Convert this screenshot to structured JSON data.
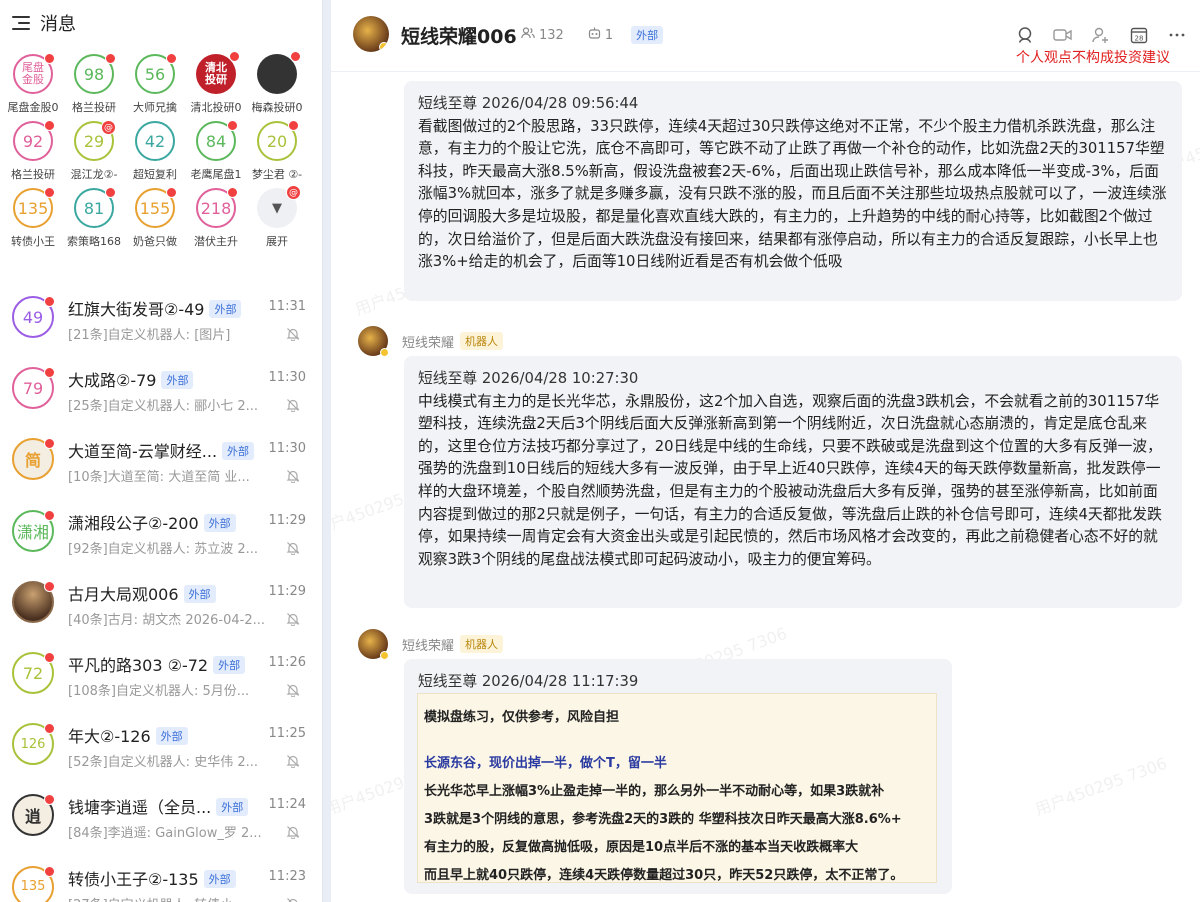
{
  "sidebar": {
    "title": "消息",
    "groups": [
      {
        "avatar_text": "尾盘\n金股",
        "label": "尾盘金股0",
        "color": "#e0609a",
        "dot": "dot"
      },
      {
        "avatar_text": "98",
        "label": "格兰投研",
        "color": "#5bb85b",
        "dot": "dot"
      },
      {
        "avatar_text": "56",
        "label": "大师兄擒",
        "color": "#5bb85b",
        "dot": "dot"
      },
      {
        "avatar_text": "清北\n投研",
        "label": "清北投研0",
        "color": "#c0202a",
        "dot": "dot",
        "img": true
      },
      {
        "avatar_text": "",
        "label": "梅森投研0",
        "color": "#333333",
        "dot": "dot",
        "img": true
      },
      {
        "avatar_text": "92",
        "label": "格兰投研",
        "color": "#e0609a",
        "dot": "dot"
      },
      {
        "avatar_text": "29",
        "label": "混江龙②-",
        "color": "#a8c23a",
        "dot": "@"
      },
      {
        "avatar_text": "42",
        "label": "超短复利",
        "color": "#3aa8a0",
        "dot": ""
      },
      {
        "avatar_text": "84",
        "label": "老鹰尾盘1",
        "color": "#5bb85b",
        "dot": "dot"
      },
      {
        "avatar_text": "20",
        "label": "梦尘君 ②-",
        "color": "#a8c23a",
        "dot": "dot"
      },
      {
        "avatar_text": "135",
        "label": "转债小王",
        "color": "#e8a030",
        "dot": "dot"
      },
      {
        "avatar_text": "81",
        "label": "索策略168",
        "color": "#3aa8a0",
        "dot": "dot"
      },
      {
        "avatar_text": "155",
        "label": "奶爸只做",
        "color": "#e8a030",
        "dot": "dot"
      },
      {
        "avatar_text": "218",
        "label": "潜伏主升",
        "color": "#e0609a",
        "dot": "dot"
      },
      {
        "avatar_text": "▼",
        "label": "展开",
        "color": "#dddddd",
        "dot": "@",
        "expand": true
      }
    ],
    "conversations": [
      {
        "avatar_text": "49",
        "color": "#9b5de5",
        "name": "红旗大街发哥②-49",
        "badge": "外部",
        "time": "11:31",
        "preview": "[21条]自定义机器人: [图片]"
      },
      {
        "avatar_text": "79",
        "color": "#e0609a",
        "name": "大成路②-79",
        "badge": "外部",
        "time": "11:30",
        "preview": "[25条]自定义机器人: 郦小七 2..."
      },
      {
        "avatar_text": "简",
        "color": "#e8a030",
        "name": "大道至简-云掌财经...",
        "badge": "外部",
        "time": "11:30",
        "preview": "[10条]大道至简: 大道至简 业...",
        "img": true
      },
      {
        "avatar_text": "潇湘",
        "color": "#5bb85b",
        "name": "潇湘段公子②-200",
        "badge": "外部",
        "time": "11:29",
        "preview": "[92条]自定义机器人: 苏立波 2..."
      },
      {
        "avatar_text": "",
        "color": "#8a6a4a",
        "name": "古月大局观006",
        "badge": "外部",
        "time": "11:29",
        "preview": "[40条]古月: 胡文杰 2026-04-2...",
        "img": true
      },
      {
        "avatar_text": "72",
        "color": "#a8c23a",
        "name": "平凡的路303 ②-72",
        "badge": "外部",
        "time": "11:26",
        "preview": "[108条]自定义机器人: 5月份..."
      },
      {
        "avatar_text": "126",
        "color": "#a8c23a",
        "name": "年大②-126",
        "badge": "外部",
        "time": "11:25",
        "preview": "[52条]自定义机器人: 史华伟 2..."
      },
      {
        "avatar_text": "逍",
        "color": "#333333",
        "name": "钱塘李逍遥（全员...",
        "badge": "外部",
        "time": "11:24",
        "preview": "[84条]李逍遥: GainGlow_罗 2...",
        "img": true
      },
      {
        "avatar_text": "135",
        "color": "#e8a030",
        "name": "转债小王子②-135",
        "badge": "外部",
        "time": "11:23",
        "preview": "[27条]自定义机器人: 转债小..."
      }
    ]
  },
  "chat": {
    "title": "短线荣耀006",
    "members": "132",
    "robots": "1",
    "badge": "外部",
    "disclaimer": "个人观点不构成投资建议",
    "watermark": "用户450295 7306",
    "messages": [
      {
        "sender": "",
        "tag": "",
        "head": "短线至尊 2026/04/28 09:56:44",
        "body": "看截图做过的2个股思路，33只跌停，连续4天超过30只跌停这绝对不正常，不少个股主力借机杀跌洗盘，那么注意，有主力的个股让它洗，底仓不高即可，等它跌不动了止跌了再做一个补仓的动作，比如洗盘2天的301157华塑科技，昨天最高大涨8.5%新高，假设洗盘被套2天-6%，后面出现止跌信号补，那么成本降低一半变成-3%，后面涨幅3%就回本，涨多了就是多赚多赢，没有只跌不涨的股，而且后面不关注那些垃圾热点股就可以了，一波连续涨停的回调股大多是垃圾股，都是量化喜欢直线大跌的，有主力的，上升趋势的中线的耐心持等，比如截图2个做过的，次日给溢价了，但是后面大跌洗盘没有接回来，结果都有涨停启动，所以有主力的合适反复跟踪，小长早上也涨3%+给走的机会了，后面等10日线附近看是否有机会做个低吸"
      },
      {
        "sender": "短线荣耀",
        "tag": "机器人",
        "head": "短线至尊 2026/04/28 10:27:30",
        "body": "中线模式有主力的是长光华芯，永鼎股份，这2个加入自选，观察后面的洗盘3跌机会，不会就看之前的301157华塑科技，连续洗盘2天后3个阴线后面大反弹涨新高到第一个阴线附近，次日洗盘就心态崩溃的，肯定是底仓乱来的，这里仓位方法技巧都分享过了，20日线是中线的生命线，只要不跌破或是洗盘到这个位置的大多有反弹一波，强势的洗盘到10日线后的短线大多有一波反弹，由于早上近40只跌停，连续4天的每天跌停数量新高，批发跌停一样的大盘环境差，个股自然顺势洗盘，但是有主力的个股被动洗盘后大多有反弹，强势的甚至涨停新高，比如前面内容提到做过的那2只就是例子，一句话，有主力的合适反复做，等洗盘后止跌的补仓信号即可，连续4天都批发跌停，如果持续一周肯定会有大资金出头或是引起民愤的，然后市场风格才会改变的，再此之前稳健者心态不好的就观察3跌3个阴线的尾盘战法模式即可起码波动小，吸主力的便宜筹码。"
      },
      {
        "sender": "短线荣耀",
        "tag": "机器人",
        "head": "短线至尊 2026/04/28 11:17:39",
        "body": ""
      }
    ],
    "image_note": {
      "line1": "模拟盘练习，仅供参考，风险自担",
      "line2": "长源东谷，现价出掉一半，做个T，留一半",
      "line3": "长光华芯早上涨幅3%止盈走掉一半的，那么另外一半不动耐心等，如果3跌就补",
      "line4": "3跌就是3个阴线的意思，参考洗盘2天的3跌的 华塑科技次日昨天最高大涨8.6%+",
      "line5": "有主力的股，反复做高抛低吸，原因是10点半后不涨的基本当天收跌概率大",
      "line6": "而且早上就40只跌停，连续4天跌停数量超过30只，昨天52只跌停，太不正常了。"
    }
  }
}
